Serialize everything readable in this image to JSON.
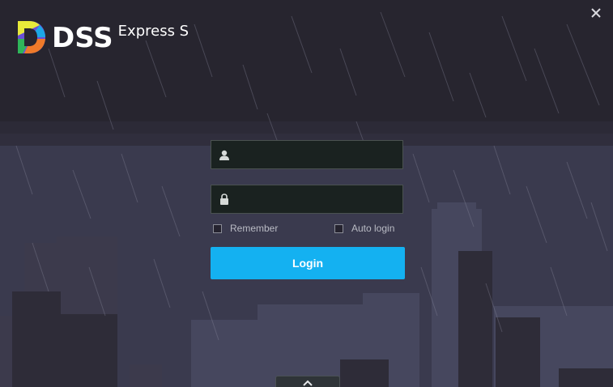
{
  "app": {
    "brand": "DSS",
    "product": "Express S"
  },
  "icons": {
    "close": "close-icon",
    "user": "user-icon",
    "lock": "lock-icon",
    "expand": "chevron-up-icon"
  },
  "form": {
    "username": {
      "value": "",
      "placeholder": ""
    },
    "password": {
      "value": "",
      "placeholder": ""
    },
    "remember_label": "Remember",
    "auto_login_label": "Auto login",
    "remember_checked": false,
    "auto_login_checked": false,
    "login_label": "Login"
  },
  "colors": {
    "accent": "#14b1f1",
    "background": "#2a2838",
    "field_bg": "#1a2220"
  }
}
